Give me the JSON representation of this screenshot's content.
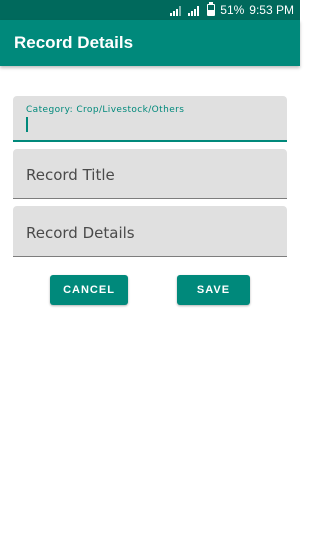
{
  "status_bar": {
    "battery_percent": "51%",
    "time": "9:53 PM",
    "icons": [
      "signal-icon",
      "signal-icon",
      "battery-icon"
    ]
  },
  "app_bar": {
    "title": "Record Details",
    "color": "#00897b"
  },
  "form": {
    "category": {
      "label": "Category: Crop/Livestock/Others",
      "value": ""
    },
    "record_title": {
      "placeholder": "Record Title"
    },
    "record_details": {
      "placeholder": "Record Details"
    }
  },
  "buttons": {
    "cancel_label": "CANCEL",
    "save_label": "SAVE"
  },
  "colors": {
    "primary": "#00897b",
    "primary_dark": "#00695c",
    "field_bg": "#e0e0e0"
  }
}
